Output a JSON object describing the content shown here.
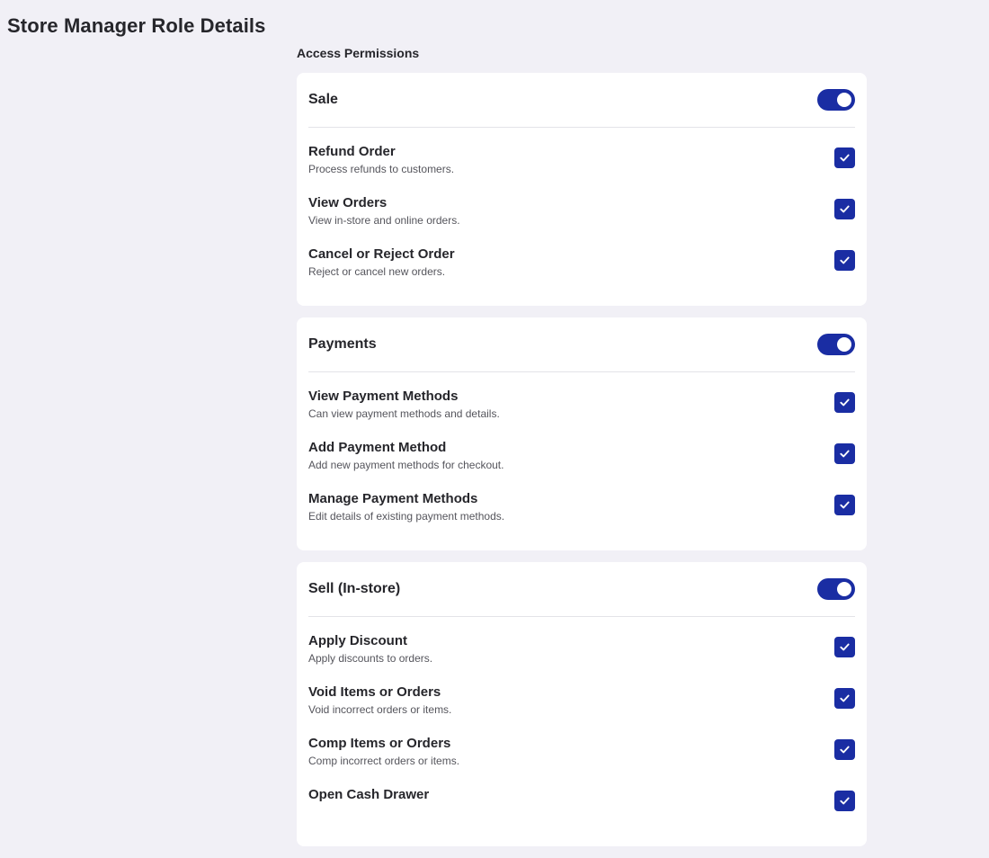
{
  "page": {
    "title": "Store Manager Role Details",
    "section_label": "Access Permissions"
  },
  "colors": {
    "background": "#f1f0f6",
    "card": "#ffffff",
    "accent": "#1a2da3"
  },
  "groups": [
    {
      "title": "Sale",
      "enabled": true,
      "permissions": [
        {
          "title": "Refund Order",
          "description": "Process refunds to customers.",
          "checked": true
        },
        {
          "title": "View Orders",
          "description": "View in-store and online orders.",
          "checked": true
        },
        {
          "title": "Cancel or Reject Order",
          "description": "Reject or cancel new orders.",
          "checked": true
        }
      ]
    },
    {
      "title": "Payments",
      "enabled": true,
      "permissions": [
        {
          "title": "View Payment Methods",
          "description": "Can view payment methods and details.",
          "checked": true
        },
        {
          "title": "Add Payment Method",
          "description": "Add new payment methods for checkout.",
          "checked": true
        },
        {
          "title": "Manage Payment Methods",
          "description": "Edit details of existing payment methods.",
          "checked": true
        }
      ]
    },
    {
      "title": "Sell (In-store)",
      "enabled": true,
      "permissions": [
        {
          "title": "Apply Discount",
          "description": "Apply discounts to orders.",
          "checked": true
        },
        {
          "title": "Void Items or Orders",
          "description": "Void incorrect orders or items.",
          "checked": true
        },
        {
          "title": "Comp Items or Orders",
          "description": "Comp incorrect orders or items.",
          "checked": true
        },
        {
          "title": "Open Cash Drawer",
          "description": "",
          "checked": true
        }
      ]
    }
  ]
}
